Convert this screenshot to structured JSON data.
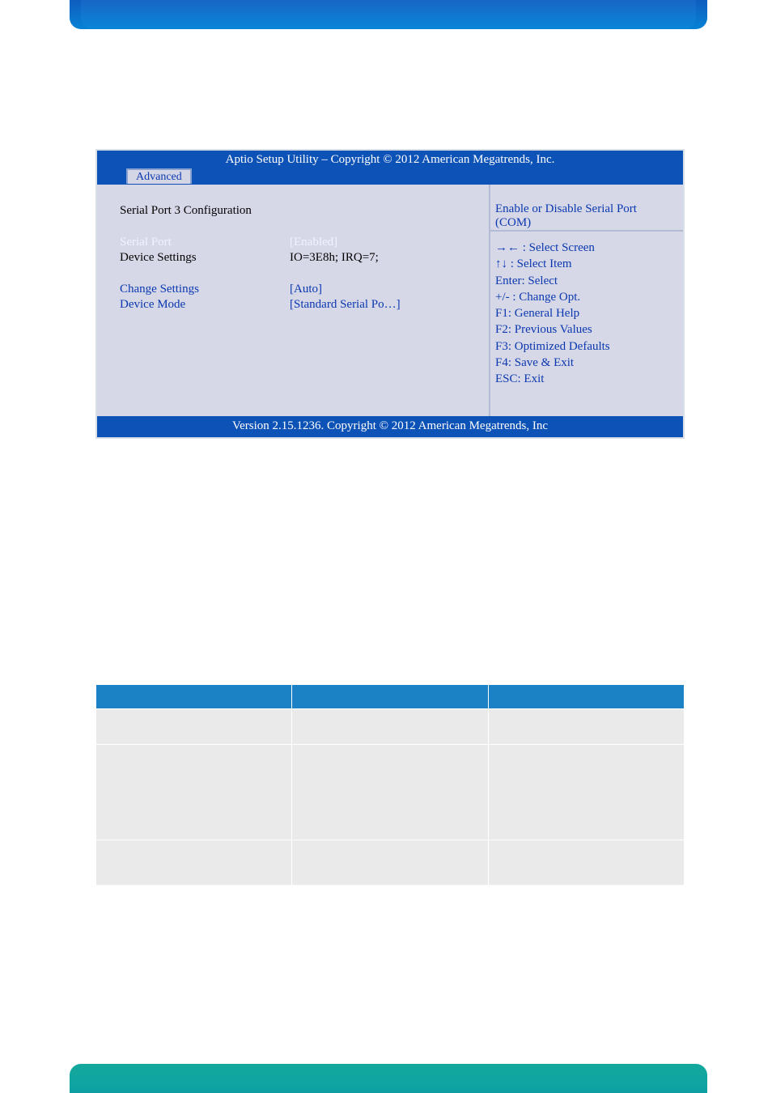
{
  "bios": {
    "title": "Aptio Setup Utility  –  Copyright © 2012 American Megatrends, Inc.",
    "tab": "Advanced",
    "section_header": "Serial Port 3 Configuration",
    "rows": {
      "serial_port_label": "Serial Port",
      "serial_port_value": "[Enabled]",
      "device_settings_label": "Device Settings",
      "device_settings_value": "IO=3E8h; IRQ=7;",
      "change_settings_label": "Change Settings",
      "change_settings_value": "[Auto]",
      "device_mode_label": "Device Mode",
      "device_mode_value": "[Standard Serial Po…]"
    },
    "help_text": "Enable or Disable Serial Port (COM)",
    "keys": [
      "→← : Select Screen",
      "↑↓ : Select Item",
      "Enter: Select",
      "+/- : Change Opt.",
      "F1: General Help",
      "F2: Previous Values",
      "F3: Optimized Defaults",
      "F4: Save & Exit",
      "ESC: Exit"
    ],
    "footer": "Version 2.15.1236. Copyright © 2012 American Megatrends, Inc"
  },
  "chart_data": {
    "type": "table",
    "columns": [
      "",
      "",
      ""
    ],
    "rows": [
      [
        "",
        "",
        ""
      ],
      [
        "",
        "",
        ""
      ],
      [
        "",
        "",
        ""
      ]
    ]
  }
}
